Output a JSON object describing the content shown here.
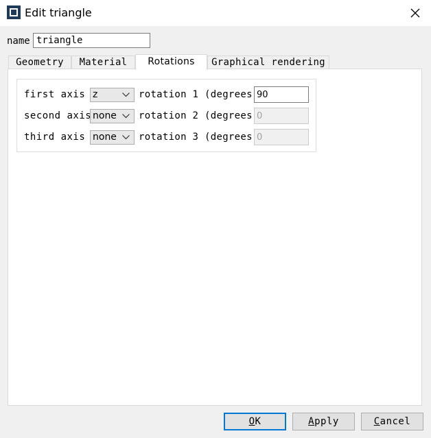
{
  "window": {
    "title": "Edit triangle",
    "icon": "app-window-icon",
    "close_icon": "close-icon"
  },
  "name_field": {
    "label": "name",
    "value": "triangle"
  },
  "tabs": [
    {
      "label": "Geometry",
      "active": false
    },
    {
      "label": "Material",
      "active": false
    },
    {
      "label": "Rotations",
      "active": true
    },
    {
      "label": "Graphical rendering",
      "active": false
    }
  ],
  "rotations": {
    "rows": [
      {
        "axis_label": "first axis",
        "axis_value": "z",
        "rotation_label": "rotation 1 (degrees)",
        "rotation_value": "90",
        "enabled": true
      },
      {
        "axis_label": "second axis",
        "axis_value": "none",
        "rotation_label": "rotation 2 (degrees)",
        "rotation_value": "0",
        "enabled": false
      },
      {
        "axis_label": "third axis",
        "axis_value": "none",
        "rotation_label": "rotation 3 (degrees)",
        "rotation_value": "0",
        "enabled": false
      }
    ]
  },
  "buttons": {
    "ok": {
      "underlined": "O",
      "rest": "K"
    },
    "apply": {
      "underlined": "A",
      "rest": "pply"
    },
    "cancel": {
      "underlined": "C",
      "rest": "ancel"
    }
  },
  "colors": {
    "accent": "#0078d7",
    "icon_bg": "#1f3b57"
  }
}
